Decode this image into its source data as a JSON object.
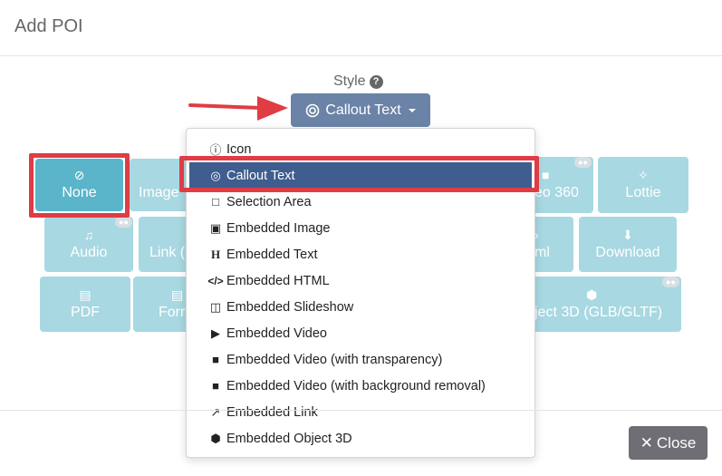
{
  "dialog": {
    "title": "Add POI",
    "close_label": "Close"
  },
  "style": {
    "label": "Style",
    "selected": "Callout Text"
  },
  "tiles": [
    {
      "label": "None",
      "icon": "ban-icon"
    },
    {
      "label": "Image",
      "icon": "image-icon"
    },
    {
      "label": "eo 360",
      "icon": "video-icon"
    },
    {
      "label": "Lottie",
      "icon": "lottie-icon"
    },
    {
      "label": "Audio",
      "icon": "music-icon"
    },
    {
      "label": "Link (",
      "icon": "link-icon"
    },
    {
      "label": "ml",
      "icon": "html-icon"
    },
    {
      "label": "Download",
      "icon": "download-icon"
    },
    {
      "label": "PDF",
      "icon": "pdf-icon"
    },
    {
      "label": "Forr",
      "icon": "form-icon"
    },
    {
      "label": "ject 3D (GLB/GLTF)",
      "icon": "cube-icon"
    }
  ],
  "dropdown": {
    "items": [
      {
        "label": "Icon",
        "icon": "info-circle-icon"
      },
      {
        "label": "Callout Text",
        "icon": "bullseye-icon"
      },
      {
        "label": "Selection Area",
        "icon": "square-icon"
      },
      {
        "label": "Embedded Image",
        "icon": "image-icon"
      },
      {
        "label": "Embedded Text",
        "icon": "heading-icon"
      },
      {
        "label": "Embedded HTML",
        "icon": "code-icon"
      },
      {
        "label": "Embedded Slideshow",
        "icon": "images-icon"
      },
      {
        "label": "Embedded Video",
        "icon": "youtube-icon"
      },
      {
        "label": "Embedded Video (with transparency)",
        "icon": "video-icon"
      },
      {
        "label": "Embedded Video (with background removal)",
        "icon": "video-icon"
      },
      {
        "label": "Embedded Link",
        "icon": "external-link-icon"
      },
      {
        "label": "Embedded Object 3D",
        "icon": "cube-icon"
      }
    ]
  },
  "colors": {
    "style_button": "#6b83a6",
    "tile": "#a8d8e2",
    "tile_active": "#5bb5ca",
    "selected_item": "#3f5d8e",
    "highlight": "#e03c44",
    "close_button": "#6e6e74"
  }
}
